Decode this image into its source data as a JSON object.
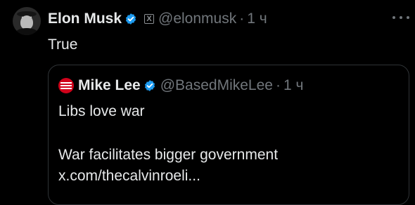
{
  "tweet": {
    "author_name": "Elon Musk",
    "handle": "@elonmusk",
    "separator": "·",
    "time": "1 ч",
    "text": "True",
    "badge_icon": "x-logo-icon",
    "more_icon": "more-horizontal-icon"
  },
  "quoted_tweet": {
    "author_name": "Mike Lee",
    "handle": "@BasedMikeLee",
    "separator": "·",
    "time": "1 ч",
    "lines": [
      "Libs love war",
      "War facilitates bigger government",
      "x.com/thecalvinroeli..."
    ]
  },
  "colors": {
    "background": "#000000",
    "text_primary": "#e7e9ea",
    "text_secondary": "#71767b",
    "verified_blue": "#1d9bf0",
    "border": "#2f3336"
  }
}
